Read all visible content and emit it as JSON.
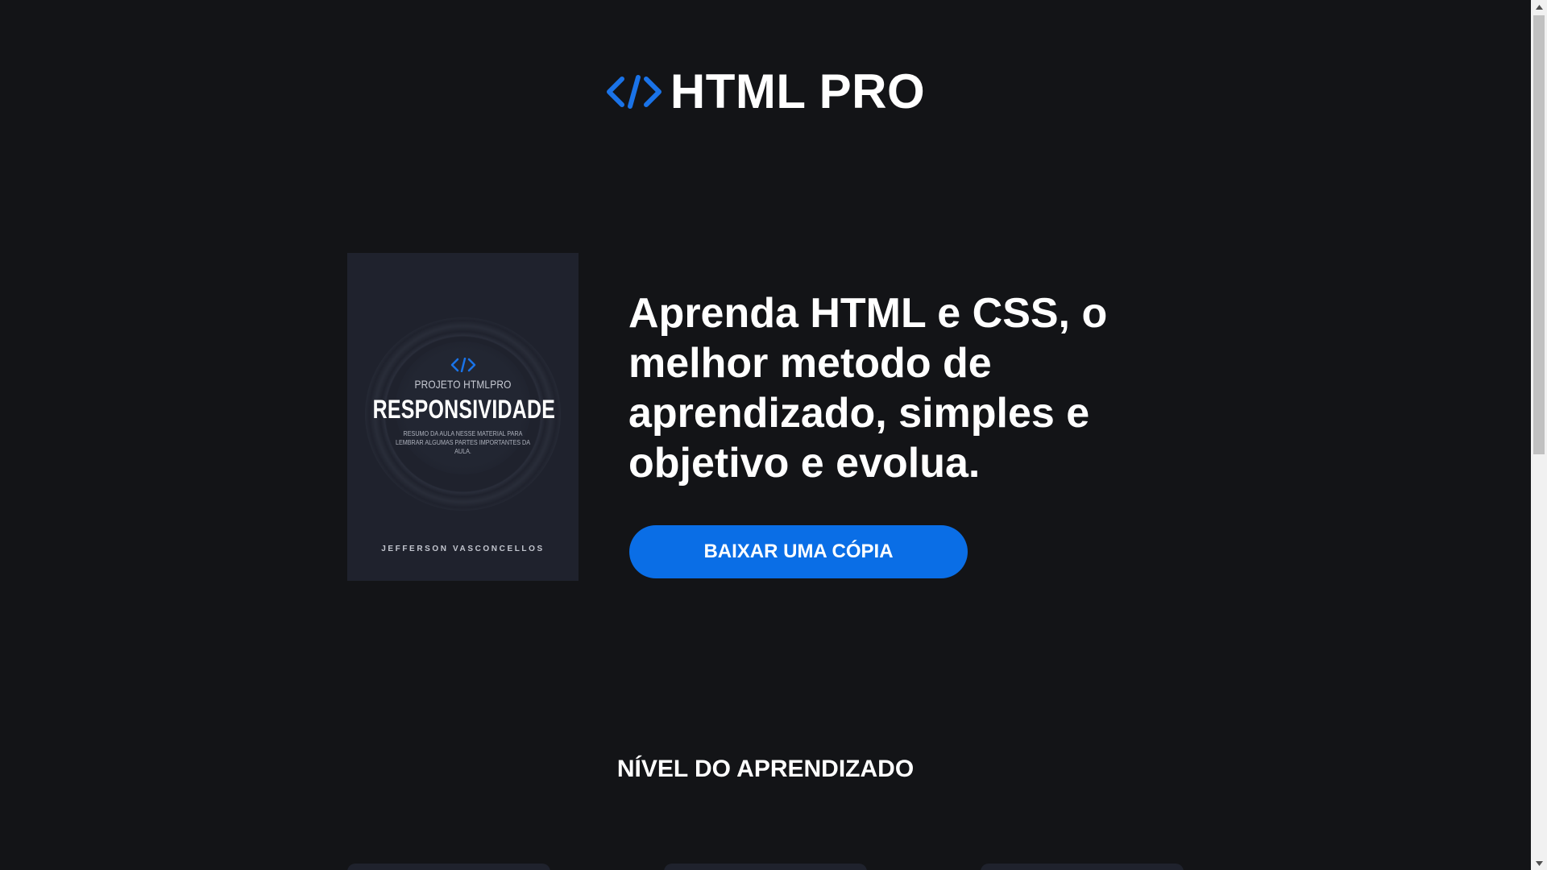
{
  "header": {
    "logo_text": "HTML PRO",
    "logo_icon": "code-brackets-icon",
    "accent_color": "#1a73e8"
  },
  "book": {
    "series": "PROJETO HTMLPRO",
    "title": "RESPONSIVIDADE",
    "description": "RESUMO DA AULA NESSE MATERIAL PARA LEMBRAR ALGUMAS PARTES IMPORTANTES DA AULA.",
    "author": "JEFFERSON VASCONCELLOS",
    "cover_color": "#1f222d"
  },
  "hero": {
    "heading": "Aprenda HTML e CSS, o melhor metodo de aprendizado, simples e objetivo e evolua.",
    "cta_label": "BAIXAR UMA CÓPIA",
    "cta_color": "#0a6ee6"
  },
  "levels": {
    "title": "NÍVEL DO APRENDIZADO"
  },
  "theme": {
    "background": "#131417",
    "text": "#ffffff"
  }
}
